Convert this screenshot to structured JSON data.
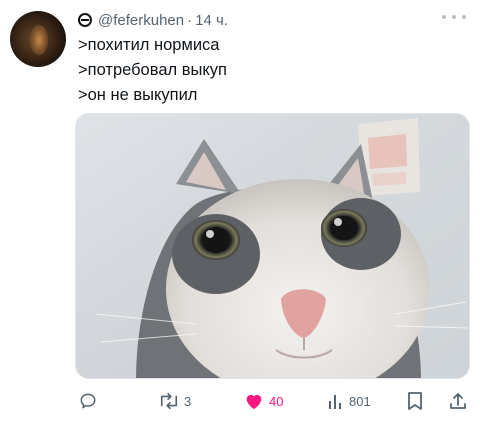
{
  "tweet": {
    "handle": "@feferkuhen",
    "separator": "·",
    "time": "14 ч.",
    "lines": [
      ">похитил нормиса",
      ">потребовал выкуп",
      ">он не выкупил"
    ]
  },
  "media": {
    "icon": "cat-photo"
  },
  "actions": {
    "reply_icon": "reply-icon",
    "retweet_count": "3",
    "like_count": "40",
    "views_count": "801",
    "bookmark_icon": "bookmark-icon",
    "share_icon": "share-icon"
  },
  "colors": {
    "like": "#f91880",
    "muted": "#536471",
    "text": "#0f1419"
  }
}
